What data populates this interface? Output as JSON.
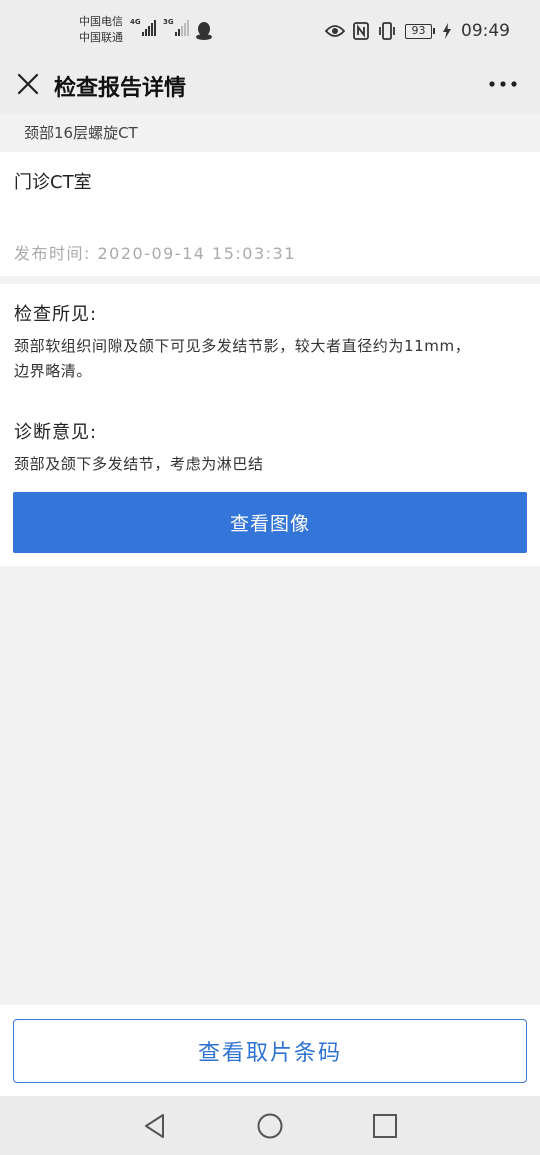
{
  "status_bar": {
    "carrier1": "中国电信",
    "carrier2": "中国联通",
    "net1_label": "4G",
    "net2_label": "3G",
    "battery": "93",
    "time": "09:49",
    "icons": [
      "eye-icon",
      "nfc-icon",
      "vibrate-icon",
      "battery-icon",
      "charging-icon",
      "qq-icon"
    ]
  },
  "header": {
    "title": "检查报告详情",
    "close_icon": "close-icon",
    "more_icon": "more-icon"
  },
  "exam_name": "颈部16层螺旋CT",
  "department": "门诊CT室",
  "publish_time": "发布时间: 2020-09-14 15:03:31",
  "findings": {
    "title": "检查所见:",
    "text_line1": "颈部软组织间隙及颌下可见多发结节影，较大者直径约为11mm，",
    "text_line2": "边界略清。"
  },
  "diagnosis": {
    "title": "诊断意见:",
    "text": "颈部及颌下多发结节，考虑为淋巴结"
  },
  "buttons": {
    "view_image": "查看图像",
    "view_barcode": "查看取片条码"
  },
  "colors": {
    "primary": "#3375d8",
    "outline": "#3a7ad5"
  }
}
